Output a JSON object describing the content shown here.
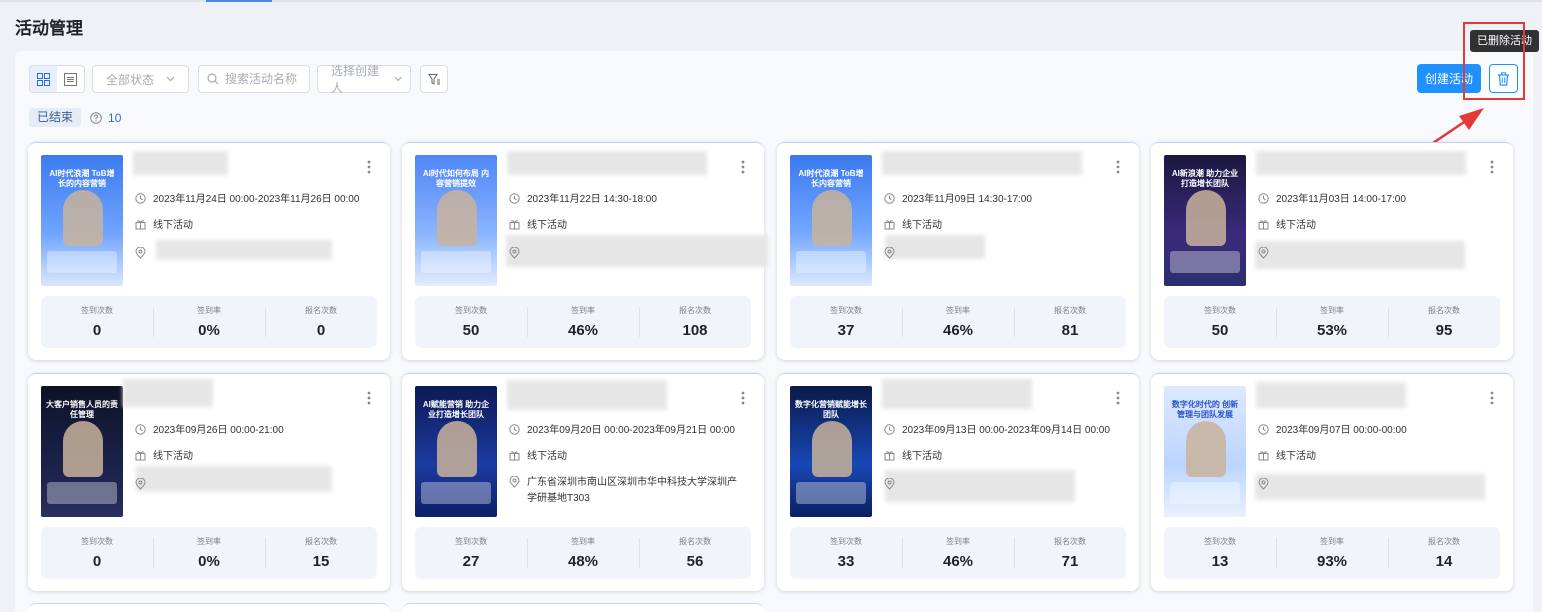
{
  "page_title": "活动管理",
  "toolbar": {
    "status_filter": "全部状态",
    "search_placeholder": "搜索活动名称",
    "creator_select": "选择创建人",
    "create_label": "创建活动",
    "deleted_tooltip": "已删除活动"
  },
  "status_group": {
    "tag": "已结束",
    "count": "10"
  },
  "stat_labels": {
    "checkin_count": "签到次数",
    "checkin_rate": "签到率",
    "signup_count": "报名次数"
  },
  "colors": {
    "accent": "#1e90ff",
    "highlight": "#e53935"
  },
  "cards": [
    {
      "poster_title": "AI时代浪潮 ToB增长的内容营销",
      "date": "2023年11月24日 00:00-2023年11月26日 00:00",
      "type": "线下活动",
      "address": "",
      "checkin": "0",
      "rate": "0%",
      "signup": "0"
    },
    {
      "poster_title": "AI时代如何布局 内容营销提效",
      "date": "2023年11月22日 14:30-18:00",
      "type": "线下活动",
      "address": "",
      "checkin": "50",
      "rate": "46%",
      "signup": "108"
    },
    {
      "poster_title": "AI时代浪潮 ToB增长内容营销",
      "date": "2023年11月09日 14:30-17:00",
      "type": "线下活动",
      "address": "",
      "checkin": "37",
      "rate": "46%",
      "signup": "81"
    },
    {
      "poster_title": "AI新浪潮 助力企业打造增长团队",
      "date": "2023年11月03日 14:00-17:00",
      "type": "线下活动",
      "address": "",
      "checkin": "50",
      "rate": "53%",
      "signup": "95"
    },
    {
      "poster_title": "大客户销售人员的责任管理",
      "date": "2023年09月26日 00:00-21:00",
      "type": "线下活动",
      "address": "",
      "checkin": "0",
      "rate": "0%",
      "signup": "15"
    },
    {
      "poster_title": "AI赋能营销 助力企业打造增长团队",
      "date": "2023年09月20日 00:00-2023年09月21日 00:00",
      "type": "线下活动",
      "address": "广东省深圳市南山区深圳市华中科技大学深圳产学研基地T303",
      "checkin": "27",
      "rate": "48%",
      "signup": "56"
    },
    {
      "poster_title": "数字化营销赋能增长团队",
      "date": "2023年09月13日 00:00-2023年09月14日 00:00",
      "type": "线下活动",
      "address": "",
      "checkin": "33",
      "rate": "46%",
      "signup": "71"
    },
    {
      "poster_title": "数字化时代的 创新管理与团队发展",
      "date": "2023年09月07日 00:00-00:00",
      "type": "线下活动",
      "address": "",
      "checkin": "13",
      "rate": "93%",
      "signup": "14"
    }
  ]
}
